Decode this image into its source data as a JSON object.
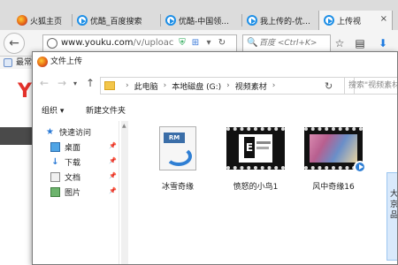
{
  "browser": {
    "tabs": [
      {
        "label": "火狐主页",
        "icon": "firefox-icon"
      },
      {
        "label": "优酷_百度搜索",
        "icon": "youku-icon"
      },
      {
        "label": "优酷-中国领...",
        "icon": "youku-icon"
      },
      {
        "label": "我上传的-优...",
        "icon": "youku-icon"
      },
      {
        "label": "上传视",
        "icon": "youku-icon",
        "close": "×"
      }
    ],
    "url_host": "www.youku.com",
    "url_path": "/v/uploac",
    "search_placeholder": "百度 <Ctrl+K>",
    "bookmarks_label": "最常"
  },
  "dialog": {
    "title": "文件上传",
    "breadcrumbs": [
      "此电脑",
      "本地磁盘 (G:)",
      "视频素材"
    ],
    "search_placeholder": "搜索\"视频素材\"",
    "organize": "组织 ▾",
    "new_folder": "新建文件夹",
    "nav_items": [
      {
        "label": "快速访问",
        "icon": "star-icon"
      },
      {
        "label": "桌面",
        "icon": "desktop-icon"
      },
      {
        "label": "下载",
        "icon": "download-icon"
      },
      {
        "label": "文档",
        "icon": "document-icon"
      },
      {
        "label": "图片",
        "icon": "picture-icon"
      }
    ],
    "files": [
      {
        "name": "冰雪奇缘",
        "type": "RM"
      },
      {
        "name": "愤怒的小鸟1",
        "type": "video"
      },
      {
        "name": "风中奇缘16",
        "type": "video"
      }
    ],
    "cutoff_text": "大 京 品"
  },
  "colors": {
    "accent": "#1e8fe6",
    "folder": "#f3c64a"
  }
}
